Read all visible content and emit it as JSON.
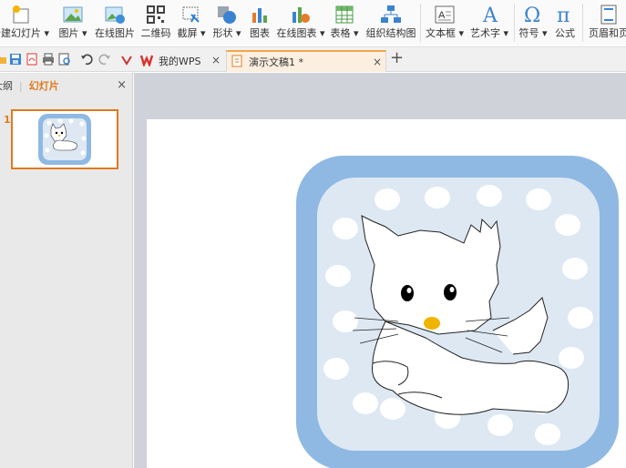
{
  "ribbon": {
    "items": [
      {
        "label": "新建幻灯片 ▾",
        "icon": "new-slide-icon"
      },
      {
        "label": "图片 ▾",
        "icon": "picture-icon"
      },
      {
        "label": "在线图片",
        "icon": "online-picture-icon"
      },
      {
        "label": "二维码",
        "icon": "qrcode-icon"
      },
      {
        "label": "截屏 ▾",
        "icon": "screenshot-icon"
      },
      {
        "label": "形状 ▾",
        "icon": "shapes-icon"
      },
      {
        "label": "图表",
        "icon": "chart-icon"
      },
      {
        "label": "在线图表 ▾",
        "icon": "online-chart-icon"
      },
      {
        "label": "表格 ▾",
        "icon": "table-icon"
      },
      {
        "label": "组织结构图",
        "icon": "org-chart-icon"
      },
      {
        "label": "文本框 ▾",
        "icon": "textbox-icon"
      },
      {
        "label": "艺术字 ▾",
        "icon": "wordart-icon"
      },
      {
        "label": "符号 ▾",
        "icon": "symbol-icon"
      },
      {
        "label": "公式",
        "icon": "formula-icon"
      },
      {
        "label": "页眉和页",
        "icon": "header-footer-icon"
      }
    ]
  },
  "tabs": {
    "home_label": "我的WPS",
    "doc_label": "演示文稿1 *",
    "new_tab_symbol": "+",
    "close_symbol": "×"
  },
  "left_pane": {
    "outline_tab": "大纲",
    "slides_tab": "幻灯片",
    "close_symbol": "×",
    "thumb_number": "1"
  },
  "colors": {
    "accent": "#e07b1e",
    "frame_blue": "#8fb9e3",
    "inner_blue": "#dde8f3"
  }
}
